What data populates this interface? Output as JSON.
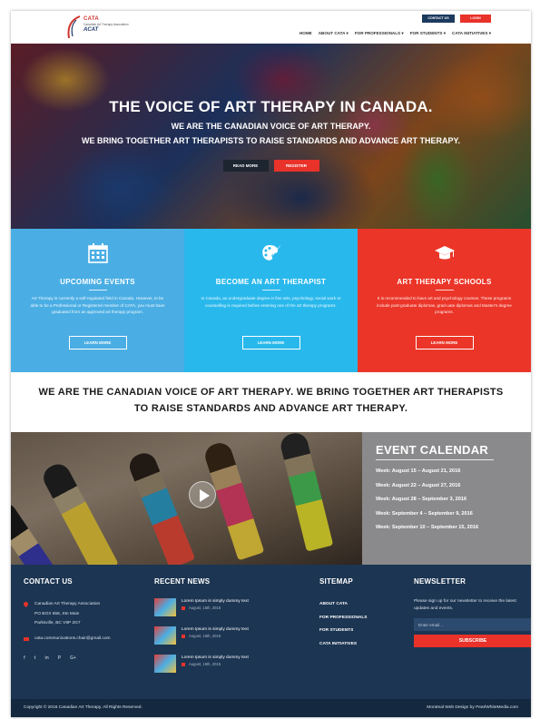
{
  "header": {
    "logo": {
      "name": "CATA",
      "tagline": "Canadian Art Therapy Association",
      "subname": "ACAT"
    },
    "top_buttons": {
      "contact": "CONTACT US",
      "login": "LOGIN"
    },
    "nav": [
      "HOME",
      "ABOUT CATA ▾",
      "FOR PROFESSIONALS ▾",
      "FOR STUDENTS ▾",
      "CATA INITIATIVES ▾"
    ]
  },
  "hero": {
    "title": "THE VOICE OF ART THERAPY IN CANADA.",
    "subtitle1": "WE ARE THE CANADIAN VOICE OF ART THERAPY.",
    "subtitle2": "WE BRING TOGETHER ART THERAPISTS TO RAISE STANDARDS AND ADVANCE ART THERAPY.",
    "read_more": "READ MORE",
    "register": "REGISTER"
  },
  "features": [
    {
      "icon": "calendar-icon",
      "title": "UPCOMING EVENTS",
      "text": "Art Therapy is currently a self-regulated field in Canada. However, to be able to be a Professional or Registered member of CATA, you must have graduated from an approved art therapy program.",
      "button": "LEARN MORE",
      "color": "#4aaee4"
    },
    {
      "icon": "palette-brush-icon",
      "title": "BECOME AN ART THERAPIST",
      "text": "In Canada, an undergraduate degree in fine arts, psychology, social work or counselling is required before entering one of the art therapy programs.",
      "button": "LEARN MORE",
      "color": "#29b8ec"
    },
    {
      "icon": "graduation-cap-icon",
      "title": "ART THERAPY SCHOOLS",
      "text": "It is recommended to have art and psychology courses. These programs include post-graduate diplomas, grad-uate diplomas and Master's degree programs.",
      "button": "LEARN MORE",
      "color": "#eb3528"
    }
  ],
  "tagline": {
    "line1": "WE ARE THE CANADIAN VOICE OF ART THERAPY. WE BRING TOGETHER ART THERAPISTS",
    "line2": "TO RAISE STANDARDS AND ADVANCE ART THERAPY."
  },
  "events": {
    "title": "EVENT CALENDAR",
    "weeks": [
      "Week: August 15 – August 21, 2016",
      "Week: August 22 – August 27, 2016",
      "Week: August 28 – September 3, 2016",
      "Week: September 4 – September 9, 2016",
      "Week: September 10 – September 15, 2016"
    ]
  },
  "footer": {
    "contact": {
      "heading": "CONTACT US",
      "org": "Canadian Art Therapy Association",
      "address1": "PO BOX 658, Stn Main",
      "address2": "Parksville, BC V9P 2G7",
      "email": "cata.communications.chair@gmail.com",
      "social": [
        "f",
        "t",
        "in",
        "P",
        "G+"
      ]
    },
    "news": {
      "heading": "RECENT NEWS",
      "items": [
        {
          "title": "Lorem Ipsum is simply dummy text",
          "date": "August, 15th, 2016"
        },
        {
          "title": "Lorem Ipsum is simply dummy text",
          "date": "August, 15th, 2016"
        },
        {
          "title": "Lorem Ipsum is simply dummy text",
          "date": "August, 15th, 2016"
        }
      ]
    },
    "sitemap": {
      "heading": "SITEMAP",
      "links": [
        "ABOUT CATA",
        "FOR PROFESSIONALS",
        "FOR STUDENTS",
        "CATA INITIATIVES"
      ]
    },
    "newsletter": {
      "heading": "NEWSLETTER",
      "text": "Please sign up for our newsletter to receive the latest updates and events.",
      "placeholder": "Enter email...",
      "button": "SUBSCRIBE"
    }
  },
  "bottom": {
    "copyright": "Copyright © 2016 Canadian Art Therapy. All Rights Reserved.",
    "credit": "Montreal Web Design by PearlWhiteMedia.com"
  }
}
